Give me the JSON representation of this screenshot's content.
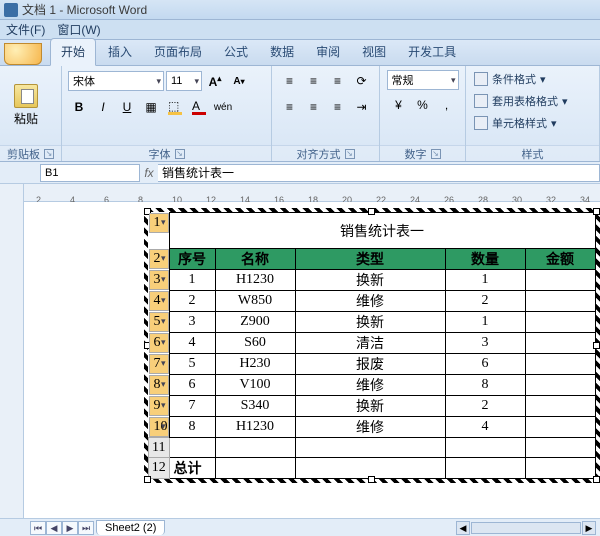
{
  "window": {
    "title": "文档 1 - Microsoft Word"
  },
  "menu": {
    "file": "文件(F)",
    "window": "窗口(W)"
  },
  "tabs": {
    "home": "开始",
    "insert": "插入",
    "layout": "页面布局",
    "formula": "公式",
    "data": "数据",
    "review": "审阅",
    "view": "视图",
    "dev": "开发工具"
  },
  "ribbon": {
    "clipboard": {
      "label": "剪贴板",
      "paste": "粘贴"
    },
    "font": {
      "label": "字体",
      "name": "宋体",
      "size": "11",
      "bold": "B",
      "italic": "I",
      "underline": "U"
    },
    "align": {
      "label": "对齐方式"
    },
    "number": {
      "label": "数字",
      "format": "常规",
      "percent": "%"
    },
    "style": {
      "label": "样式",
      "cond": "条件格式",
      "tblfmt": "套用表格格式",
      "cellstyle": "单元格样式"
    }
  },
  "name_box": "B1",
  "formula_bar": "销售统计表一",
  "ruler": [
    "2",
    "4",
    "6",
    "8",
    "10",
    "12",
    "14",
    "16",
    "18",
    "20",
    "22",
    "24",
    "26",
    "28",
    "30",
    "32",
    "34"
  ],
  "table": {
    "title": "销售统计表一",
    "headers": {
      "seq": "序号",
      "name": "名称",
      "type": "类型",
      "qty": "数量",
      "amt": "金额"
    },
    "rows": [
      {
        "seq": "1",
        "name": "H1230",
        "type": "换新",
        "qty": "1",
        "amt": ""
      },
      {
        "seq": "2",
        "name": "W850",
        "type": "维修",
        "qty": "2",
        "amt": ""
      },
      {
        "seq": "3",
        "name": "Z900",
        "type": "换新",
        "qty": "1",
        "amt": ""
      },
      {
        "seq": "4",
        "name": "S60",
        "type": "清洁",
        "qty": "3",
        "amt": ""
      },
      {
        "seq": "5",
        "name": "H230",
        "type": "报废",
        "qty": "6",
        "amt": ""
      },
      {
        "seq": "6",
        "name": "V100",
        "type": "维修",
        "qty": "8",
        "amt": ""
      },
      {
        "seq": "7",
        "name": "S340",
        "type": "换新",
        "qty": "2",
        "amt": ""
      },
      {
        "seq": "8",
        "name": "H1230",
        "type": "维修",
        "qty": "4",
        "amt": ""
      }
    ],
    "total_label": "总计"
  },
  "sheet_tab": "Sheet2 (2)"
}
